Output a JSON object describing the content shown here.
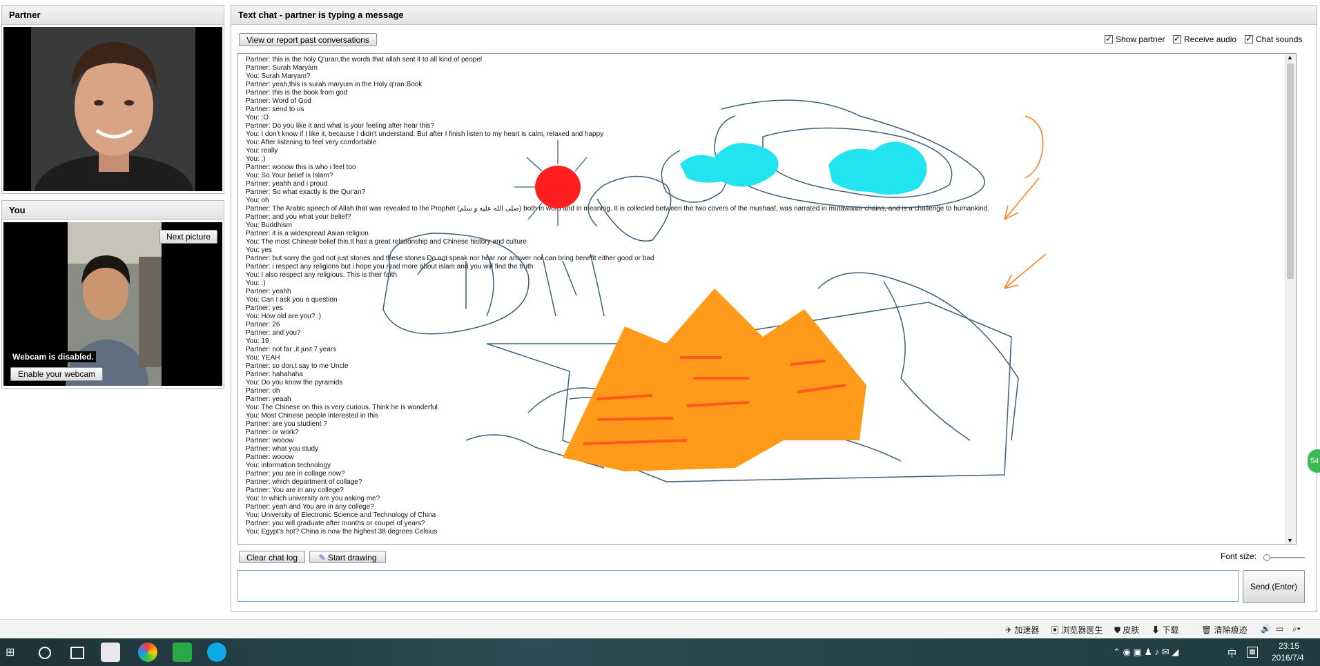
{
  "partner_panel": {
    "title": "Partner"
  },
  "you_panel": {
    "title": "You",
    "next_picture": "Next picture",
    "webcam_status": "Webcam is disabled.",
    "enable_webcam": "Enable your webcam"
  },
  "chat_panel": {
    "title": "Text chat - partner is typing a message",
    "view_report": "View or report past conversations",
    "checkboxes": [
      {
        "label": "Show partner",
        "checked": true
      },
      {
        "label": "Receive audio",
        "checked": true
      },
      {
        "label": "Chat sounds",
        "checked": true
      }
    ],
    "messages": [
      "Partner: this is the holy Q'uran,the words that allah sent it to all kind of peopel",
      "Partner: Surah Maryam",
      "You: Surah Maryam?",
      "Partner: yeah,this is surah maryum in the Holy q'ran Book",
      "Partner: this is the book from god",
      "Partner: Word of God",
      "Partner: send to us",
      "You: :O",
      "Partner: Do you like it and what is your feeling after hear this?",
      "You: I don't know if I like it, because I didn't understand. But after I finish listen to my heart is calm, relaxed and happy",
      "You: After listening to feel very comfortable",
      "You: really",
      "You: :)",
      "Partner: wooow this is who i feel too",
      "You: So Your belief is Islam?",
      "Partner: yeahh and i proud",
      "Partner: So what exactly is the Qur'an?",
      "You: oh",
      "Partner: The Arabic speech of Allah that was revealed to the Prophet (صلى الله عليه و سلم) both in word and in meaning. It is collected between the two covers of the mushaaf, was narrated in mutawaatir chains, and is a challenge to humankind.",
      "Partner: and you what your belief?",
      "You: Buddhism",
      "Partner: it is a widespread Asian religion",
      "You: The most Chinese belief this.It has a great relationship and Chinese history and culture",
      "You: yes",
      "Partner: but sorry the god not just stones and these stones Do not speak nor hear nor answer nor can bring benefit either good or bad",
      "Partner: i respect any religions but i hope you read more about islam and you will find the truth",
      "You: I also respect any religious. This is their faith",
      "You: :)",
      "Partner: yeahh",
      "You: Can I ask you a question",
      "Partner: yes",
      "You: How old are you? :)",
      "Partner: 26",
      "Partner: and you?",
      "You: 19",
      "Partner: not far ,it just 7 years",
      "You: YEAH",
      "Partner: so don,t say to me Uncle",
      "Partner: hahahaha",
      "You: Do you know the pyramids",
      "Partner: oh",
      "Partner: yeaah",
      "You: The Chinese on this is very curious. Think he is wonderful",
      "You: Most Chinese people interested in this",
      "Partner: are you studient ?",
      "Partner: or work?",
      "Partner: wooow",
      "Partner: what you study",
      "Partner: wooow",
      "You: information technology",
      "Partner: you are in collage now?",
      "Partner: which department of collage?",
      "Partner: You are in any college?",
      "You: In which university are you asking me?",
      "Partner: yeah and You are in any college?",
      "You: University of Electronic Science and Technology of China",
      "Partner: you will graduate after months or coupel of years?",
      "You: Egypt's hot? China is now the highest 38 degrees Celsius"
    ],
    "clear_log": "Clear chat log",
    "start_drawing": "Start drawing",
    "font_size_label": "Font size:",
    "input_value": "",
    "send": "Send (Enter)"
  },
  "browser_status": {
    "items": [
      "加速器",
      "浏览器医生",
      "皮肤",
      "下载",
      "清除痕迹"
    ]
  },
  "taskbar": {
    "time": "23:15",
    "date": "2016/7/4",
    "ime": "中"
  },
  "side_badge": "54"
}
